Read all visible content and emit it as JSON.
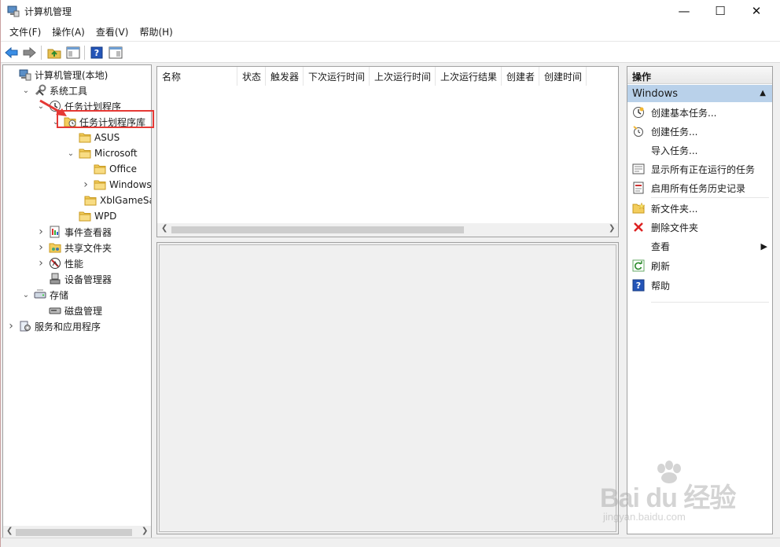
{
  "window": {
    "title": "计算机管理",
    "controls": {
      "minimize": "—",
      "maximize": "☐",
      "close": "✕"
    }
  },
  "menu": [
    "文件(F)",
    "操作(A)",
    "查看(V)",
    "帮助(H)"
  ],
  "toolbar": {
    "icons": [
      "back-icon",
      "forward-icon",
      "up-folder-icon",
      "show-hide-tree-icon",
      "help-icon",
      "show-hide-action-pane-icon"
    ]
  },
  "tree": {
    "items": [
      {
        "label": "计算机管理(本地)",
        "icon": "computer-management-icon",
        "arrow": ""
      },
      {
        "label": "系统工具",
        "icon": "tools-icon",
        "arrow": "expanded"
      },
      {
        "label": "任务计划程序",
        "icon": "clock-icon",
        "arrow": "expanded"
      },
      {
        "label": "任务计划程序库",
        "icon": "task-library-icon",
        "arrow": "expanded"
      },
      {
        "label": "ASUS",
        "icon": "folder-icon",
        "arrow": ""
      },
      {
        "label": "Microsoft",
        "icon": "folder-icon",
        "arrow": "expanded"
      },
      {
        "label": "Office",
        "icon": "folder-icon",
        "arrow": ""
      },
      {
        "label": "Windows",
        "icon": "folder-icon",
        "arrow": "collapsed",
        "selected": true
      },
      {
        "label": "XblGameSa",
        "icon": "folder-icon",
        "arrow": ""
      },
      {
        "label": "WPD",
        "icon": "folder-icon",
        "arrow": ""
      },
      {
        "label": "事件查看器",
        "icon": "event-viewer-icon",
        "arrow": "collapsed"
      },
      {
        "label": "共享文件夹",
        "icon": "shared-folder-icon",
        "arrow": "collapsed"
      },
      {
        "label": "性能",
        "icon": "performance-icon",
        "arrow": "collapsed"
      },
      {
        "label": "设备管理器",
        "icon": "device-manager-icon",
        "arrow": ""
      },
      {
        "label": "存储",
        "icon": "storage-icon",
        "arrow": "expanded"
      },
      {
        "label": "磁盘管理",
        "icon": "disk-icon",
        "arrow": ""
      },
      {
        "label": "服务和应用程序",
        "icon": "services-icon",
        "arrow": "collapsed"
      }
    ]
  },
  "list": {
    "columns": [
      "名称",
      "状态",
      "触发器",
      "下次运行时间",
      "上次运行时间",
      "上次运行结果",
      "创建者",
      "创建时间"
    ]
  },
  "actions": {
    "header": "操作",
    "section": "Windows",
    "items": [
      {
        "label": "创建基本任务...",
        "icon": "create-basic-task-icon"
      },
      {
        "label": "创建任务...",
        "icon": "create-task-icon"
      },
      {
        "label": "导入任务...",
        "icon": ""
      },
      {
        "label": "显示所有正在运行的任务",
        "icon": "running-tasks-icon"
      },
      {
        "label": "启用所有任务历史记录",
        "icon": "task-history-icon"
      },
      {
        "label": "新文件夹...",
        "icon": "new-folder-icon"
      },
      {
        "label": "删除文件夹",
        "icon": "delete-icon"
      },
      {
        "label": "查看",
        "icon": "",
        "submenu": true
      },
      {
        "label": "刷新",
        "icon": "refresh-icon"
      },
      {
        "label": "帮助",
        "icon": "help-icon"
      }
    ]
  },
  "watermark": {
    "brand": "Bai du 经验",
    "url": "jingyan.baidu.com"
  },
  "colors": {
    "selection": "#b9d1ea",
    "highlight_box": "#e53935",
    "accent_blue": "#1e6fc9"
  }
}
